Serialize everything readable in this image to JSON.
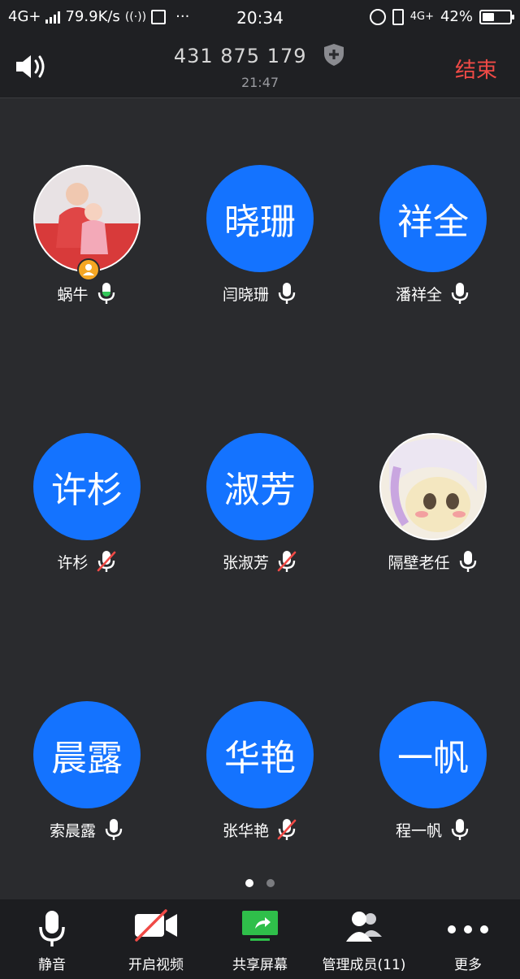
{
  "status_bar": {
    "network": "4G+",
    "speed": "79.9K/s",
    "dots": "···",
    "time": "20:34",
    "network_right": "4G+",
    "battery_pct": "42%"
  },
  "header": {
    "meeting_id": "431 875 179",
    "timer": "21:47",
    "end_label": "结束"
  },
  "participants": [
    {
      "avatar_text": "",
      "name": "蜗牛",
      "muted": false,
      "photo": true,
      "host": true
    },
    {
      "avatar_text": "晓珊",
      "name": "闫晓珊",
      "muted": false
    },
    {
      "avatar_text": "祥全",
      "name": "潘祥全",
      "muted": false
    },
    {
      "avatar_text": "许杉",
      "name": "许杉",
      "muted": true
    },
    {
      "avatar_text": "淑芳",
      "name": "张淑芳",
      "muted": true
    },
    {
      "avatar_text": "",
      "name": "隔壁老任",
      "muted": false,
      "photo": true
    },
    {
      "avatar_text": "晨露",
      "name": "索晨露",
      "muted": false
    },
    {
      "avatar_text": "华艳",
      "name": "张华艳",
      "muted": true
    },
    {
      "avatar_text": "一帆",
      "name": "程一帆",
      "muted": false
    }
  ],
  "toolbar": {
    "mute_label": "静音",
    "video_label": "开启视频",
    "share_label": "共享屏幕",
    "members_label": "管理成员(11)",
    "more_label": "更多"
  },
  "colors": {
    "avatar_blue": "#1473ff",
    "end_red": "#f04a46",
    "mic_green": "#34c759",
    "mute_red": "#f04a46",
    "background": "#2a2b2e"
  }
}
